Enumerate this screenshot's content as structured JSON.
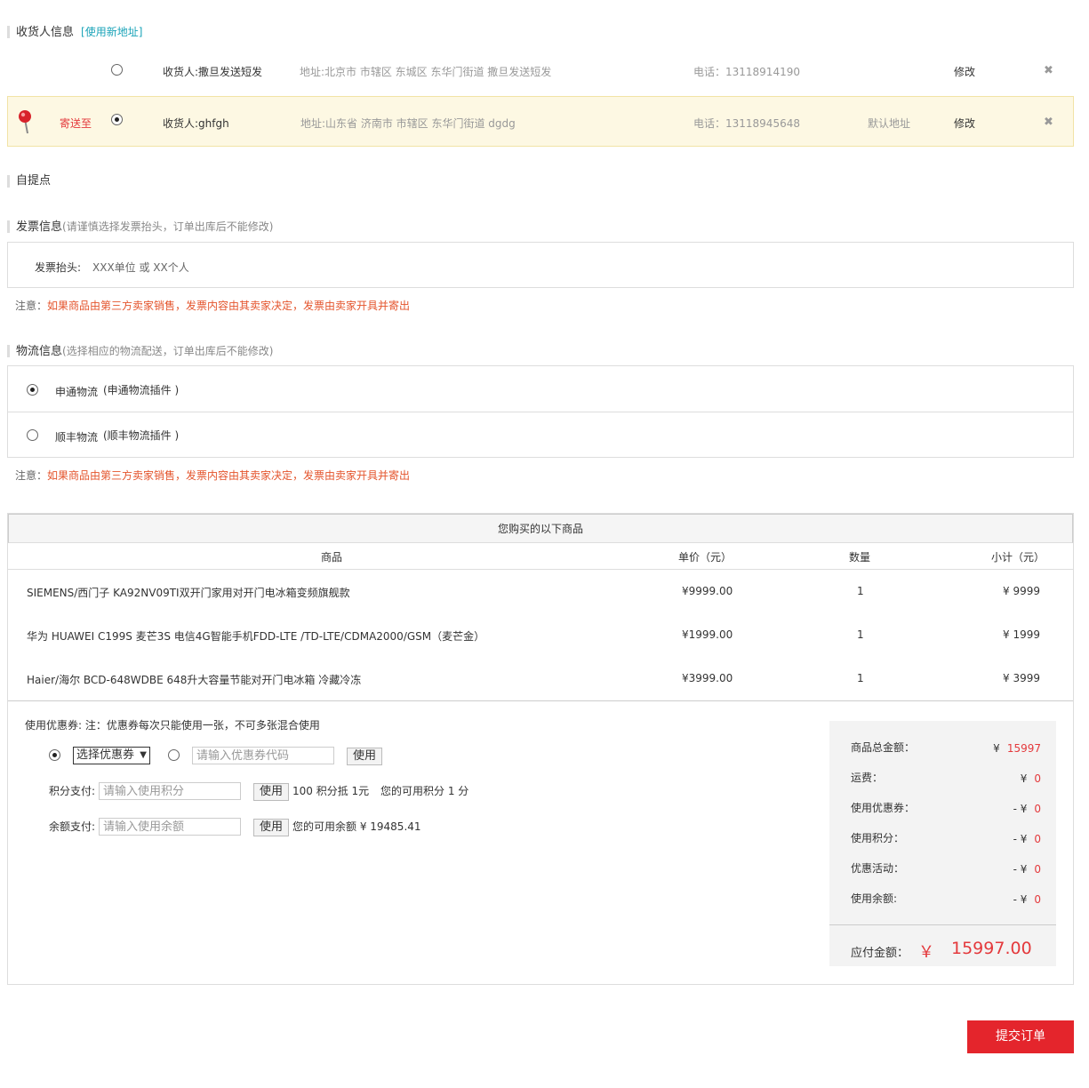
{
  "receiver": {
    "title": "收货人信息",
    "new_address": "[使用新地址]",
    "addresses": [
      {
        "name": "收货人:撒旦发送短发",
        "address": "地址:北京市 市辖区 东城区 东华门街道 撒旦发送短发",
        "phone": "电话：13118914190",
        "default": "",
        "edit": "修改",
        "delete": "✖"
      },
      {
        "name": "收货人:ghfgh",
        "address": "地址:山东省 济南市 市辖区 东华门街道 dgdg",
        "phone": "电话：13118945648",
        "default": "默认地址",
        "edit": "修改",
        "delete": "✖",
        "send_to": "寄送至"
      }
    ]
  },
  "pickup": {
    "title": "自提点"
  },
  "invoice": {
    "title": "发票信息",
    "hint": "(请谨慎选择发票抬头，订单出库后不能修改)",
    "label": "发票抬头:",
    "value": "XXX单位 或 XX个人"
  },
  "note1": {
    "prefix": "注意：",
    "text": "如果商品由第三方卖家销售，发票内容由其卖家决定，发票由卖家开具并寄出"
  },
  "logistics": {
    "title": "物流信息",
    "hint": "(选择相应的物流配送，订单出库后不能修改)",
    "options": [
      {
        "name": "申通物流",
        "plugin": "(申通物流插件 )"
      },
      {
        "name": "顺丰物流",
        "plugin": "(顺丰物流插件 )"
      }
    ]
  },
  "note2": {
    "prefix": "注意：",
    "text": "如果商品由第三方卖家销售，发票内容由其卖家决定，发票由卖家开具并寄出"
  },
  "goods": {
    "title": "您购买的以下商品",
    "columns": [
      "商品",
      "单价（元）",
      "数量",
      "小计（元）"
    ],
    "rows": [
      {
        "name": "SIEMENS/西门子 KA92NV09TI双开门家用对开门电冰箱变频旗舰款",
        "price": "¥9999.00",
        "qty": "1",
        "subtotal": "¥ 9999"
      },
      {
        "name": "华为 HUAWEI C199S 麦芒3S 电信4G智能手机FDD-LTE /TD-LTE/CDMA2000/GSM（麦芒金）",
        "price": "¥1999.00",
        "qty": "1",
        "subtotal": "¥ 1999"
      },
      {
        "name": "Haier/海尔 BCD-648WDBE 648升大容量节能对开门电冰箱 冷藏冷冻",
        "price": "¥3999.00",
        "qty": "1",
        "subtotal": "¥ 3999"
      }
    ]
  },
  "payment": {
    "coupon_title": "使用优惠券: 注：优惠券每次只能使用一张，不可多张混合使用",
    "coupon_select": "选择优惠券",
    "coupon_placeholder": "请输入优惠券代码",
    "use": "使用",
    "points_label": "积分支付:",
    "points_placeholder": "请输入使用积分",
    "points_rule": "100 积分抵 1元",
    "points_available": "您的可用积分 1 分",
    "balance_label": "余额支付:",
    "balance_placeholder": "请输入使用余额",
    "balance_available": "您的可用余额 ¥ 19485.41"
  },
  "summary": {
    "items": [
      {
        "label": "商品总金额：",
        "sign": "¥",
        "value": "15997"
      },
      {
        "label": "运费：",
        "sign": "¥",
        "value": "0"
      },
      {
        "label": "使用优惠券：",
        "sign": "- ¥",
        "value": "0"
      },
      {
        "label": "使用积分：",
        "sign": "- ¥",
        "value": "0"
      },
      {
        "label": "优惠活动：",
        "sign": "- ¥",
        "value": "0"
      },
      {
        "label": "使用余额:",
        "sign": "- ¥",
        "value": "0"
      }
    ],
    "payable_label": "应付金额：",
    "payable_sign": "￥",
    "payable_value": "15997.00"
  },
  "submit": "提交订单",
  "colors": {
    "accent": "#e4252c",
    "link": "#1aa3b8",
    "warn": "#e4542c",
    "selected_bg": "#fdf8e3"
  }
}
